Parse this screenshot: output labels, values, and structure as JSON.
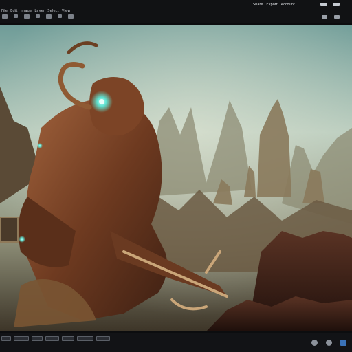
{
  "topbar": {
    "menu": [
      "File",
      "Edit",
      "Image",
      "Layer",
      "Select",
      "View"
    ],
    "right_links": [
      "Share",
      "Export",
      "Account"
    ]
  },
  "colors": {
    "sky_top": "#9ec3bc",
    "sky_mid": "#c9d6c2",
    "mountain": "#6e6a55",
    "armor": "#7a3f22",
    "glow": "#6fe7d7",
    "rock": "#3a1e16"
  },
  "icons": {
    "toolbar": [
      "move-icon",
      "brush-icon",
      "crop-icon",
      "text-icon",
      "shape-icon",
      "zoom-icon",
      "hand-icon"
    ],
    "topright": [
      "settings-icon",
      "share-icon"
    ],
    "bottom": [
      "layers-icon",
      "history-icon",
      "adjust-icon",
      "info-icon",
      "grid-icon"
    ]
  }
}
